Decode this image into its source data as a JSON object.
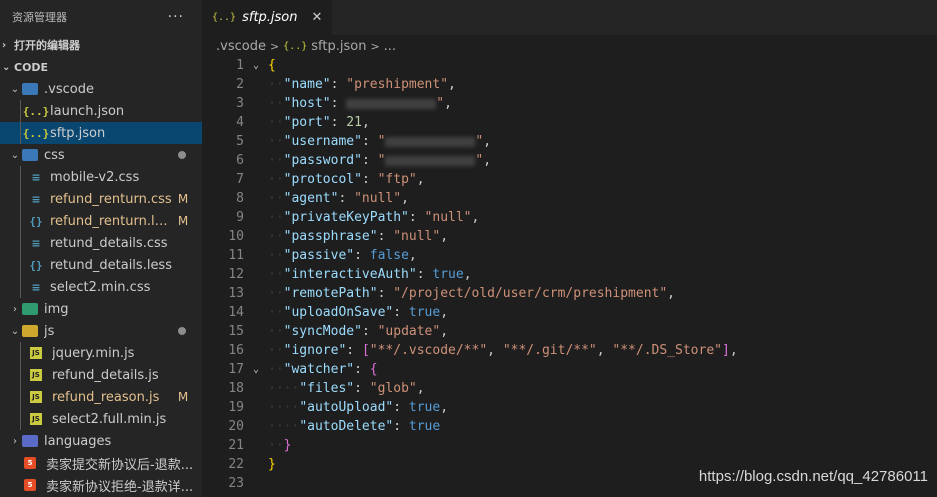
{
  "sidebar": {
    "title": "资源管理器",
    "more": "···",
    "open_editors": "打开的编辑器",
    "workspace": "CODE",
    "tree": [
      {
        "label": ".vscode",
        "type": "folder",
        "level": 1,
        "open": true,
        "folder_color": "vscode"
      },
      {
        "label": "launch.json",
        "type": "json",
        "level": 2
      },
      {
        "label": "sftp.json",
        "type": "json",
        "level": 2,
        "selected": true
      },
      {
        "label": "css",
        "type": "folder",
        "level": 1,
        "open": true,
        "dot": true,
        "folder_color": "css"
      },
      {
        "label": "mobile-v2.css",
        "type": "css",
        "level": 2
      },
      {
        "label": "refund_renturn.css",
        "type": "css",
        "level": 2,
        "badge": "M"
      },
      {
        "label": "refund_renturn.less",
        "type": "less",
        "level": 2,
        "badge": "M"
      },
      {
        "label": "retund_details.css",
        "type": "css",
        "level": 2
      },
      {
        "label": "retund_details.less",
        "type": "less",
        "level": 2
      },
      {
        "label": "select2.min.css",
        "type": "css",
        "level": 2
      },
      {
        "label": "img",
        "type": "folder",
        "level": 1,
        "open": false,
        "folder_color": "img"
      },
      {
        "label": "js",
        "type": "folder",
        "level": 1,
        "open": true,
        "dot": true,
        "folder_color": "js"
      },
      {
        "label": "jquery.min.js",
        "type": "js",
        "level": 2
      },
      {
        "label": "refund_details.js",
        "type": "js",
        "level": 2
      },
      {
        "label": "refund_reason.js",
        "type": "js",
        "level": 2,
        "badge": "M"
      },
      {
        "label": "select2.full.min.js",
        "type": "js",
        "level": 2
      },
      {
        "label": "languages",
        "type": "folder",
        "level": 1,
        "open": false,
        "folder_color": "lang"
      },
      {
        "label": "卖家提交新协议后-退款...",
        "type": "html",
        "level": 1
      },
      {
        "label": "卖家新协议拒绝-退款详...",
        "type": "html",
        "level": 1
      }
    ]
  },
  "editor": {
    "tab_label": "sftp.json",
    "tab_icon": "{..}",
    "close": "✕",
    "breadcrumb": [
      ".vscode",
      "sftp.json",
      "..."
    ],
    "lines": [
      [
        [
          "brace-y",
          "{"
        ]
      ],
      [
        [
          "ws",
          "··"
        ],
        [
          "key",
          "\"name\""
        ],
        [
          "punc",
          ": "
        ],
        [
          "str",
          "\"preshipment\""
        ],
        [
          "punc",
          ","
        ]
      ],
      [
        [
          "ws",
          "··"
        ],
        [
          "key",
          "\"host\""
        ],
        [
          "punc",
          ": "
        ],
        [
          "blur",
          ""
        ],
        [
          "str",
          "\""
        ],
        [
          "punc",
          ","
        ]
      ],
      [
        [
          "ws",
          "··"
        ],
        [
          "key",
          "\"port\""
        ],
        [
          "punc",
          ": "
        ],
        [
          "num",
          "21"
        ],
        [
          "punc",
          ","
        ]
      ],
      [
        [
          "ws",
          "··"
        ],
        [
          "key",
          "\"username\""
        ],
        [
          "punc",
          ": "
        ],
        [
          "str",
          "\""
        ],
        [
          "blur",
          ""
        ],
        [
          "str",
          "\""
        ],
        [
          "punc",
          ","
        ]
      ],
      [
        [
          "ws",
          "··"
        ],
        [
          "key",
          "\"password\""
        ],
        [
          "punc",
          ": "
        ],
        [
          "str",
          "\""
        ],
        [
          "blur",
          ""
        ],
        [
          "str",
          "\""
        ],
        [
          "punc",
          ","
        ]
      ],
      [
        [
          "ws",
          "··"
        ],
        [
          "key",
          "\"protocol\""
        ],
        [
          "punc",
          ": "
        ],
        [
          "str",
          "\"ftp\""
        ],
        [
          "punc",
          ","
        ]
      ],
      [
        [
          "ws",
          "··"
        ],
        [
          "key",
          "\"agent\""
        ],
        [
          "punc",
          ": "
        ],
        [
          "str",
          "\"null\""
        ],
        [
          "punc",
          ","
        ]
      ],
      [
        [
          "ws",
          "··"
        ],
        [
          "key",
          "\"privateKeyPath\""
        ],
        [
          "punc",
          ": "
        ],
        [
          "str",
          "\"null\""
        ],
        [
          "punc",
          ","
        ]
      ],
      [
        [
          "ws",
          "··"
        ],
        [
          "key",
          "\"passphrase\""
        ],
        [
          "punc",
          ": "
        ],
        [
          "str",
          "\"null\""
        ],
        [
          "punc",
          ","
        ]
      ],
      [
        [
          "ws",
          "··"
        ],
        [
          "key",
          "\"passive\""
        ],
        [
          "punc",
          ": "
        ],
        [
          "bool",
          "false"
        ],
        [
          "punc",
          ","
        ]
      ],
      [
        [
          "ws",
          "··"
        ],
        [
          "key",
          "\"interactiveAuth\""
        ],
        [
          "punc",
          ": "
        ],
        [
          "bool",
          "true"
        ],
        [
          "punc",
          ","
        ]
      ],
      [
        [
          "ws",
          "··"
        ],
        [
          "key",
          "\"remotePath\""
        ],
        [
          "punc",
          ": "
        ],
        [
          "str",
          "\"/project/old/user/crm/preshipment\""
        ],
        [
          "punc",
          ","
        ]
      ],
      [
        [
          "ws",
          "··"
        ],
        [
          "key",
          "\"uploadOnSave\""
        ],
        [
          "punc",
          ": "
        ],
        [
          "bool",
          "true"
        ],
        [
          "punc",
          ","
        ]
      ],
      [
        [
          "ws",
          "··"
        ],
        [
          "key",
          "\"syncMode\""
        ],
        [
          "punc",
          ": "
        ],
        [
          "str",
          "\"update\""
        ],
        [
          "punc",
          ","
        ]
      ],
      [
        [
          "ws",
          "··"
        ],
        [
          "key",
          "\"ignore\""
        ],
        [
          "punc",
          ": "
        ],
        [
          "brace",
          "["
        ],
        [
          "str",
          "\"**/.vscode/**\""
        ],
        [
          "punc",
          ", "
        ],
        [
          "str",
          "\"**/.git/**\""
        ],
        [
          "punc",
          ", "
        ],
        [
          "str",
          "\"**/.DS_Store\""
        ],
        [
          "brace",
          "]"
        ],
        [
          "punc",
          ","
        ]
      ],
      [
        [
          "ws",
          "··"
        ],
        [
          "key",
          "\"watcher\""
        ],
        [
          "punc",
          ": "
        ],
        [
          "brace",
          "{"
        ]
      ],
      [
        [
          "ws",
          "····"
        ],
        [
          "key",
          "\"files\""
        ],
        [
          "punc",
          ": "
        ],
        [
          "str",
          "\"glob\""
        ],
        [
          "punc",
          ","
        ]
      ],
      [
        [
          "ws",
          "····"
        ],
        [
          "key",
          "\"autoUpload\""
        ],
        [
          "punc",
          ": "
        ],
        [
          "bool",
          "true"
        ],
        [
          "punc",
          ","
        ]
      ],
      [
        [
          "ws",
          "····"
        ],
        [
          "key",
          "\"autoDelete\""
        ],
        [
          "punc",
          ": "
        ],
        [
          "bool",
          "true"
        ]
      ],
      [
        [
          "ws",
          "··"
        ],
        [
          "brace",
          "}"
        ]
      ],
      [
        [
          "brace-y",
          "}"
        ]
      ],
      []
    ],
    "fold_lines": [
      1,
      17
    ]
  },
  "watermark": "https://blog.csdn.net/qq_42786011"
}
